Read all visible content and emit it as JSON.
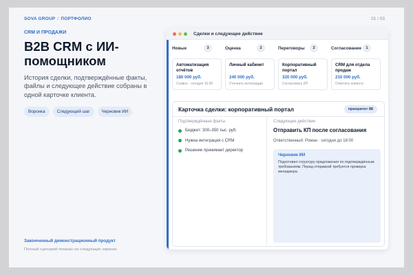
{
  "header": {
    "brand": "SOVA GROUP",
    "separator": "/",
    "section": "ПОРТФОЛИО",
    "pager": "01 / 03"
  },
  "hero": {
    "eyebrow": "CRM И ПРОДАЖИ",
    "title": "B2B CRM с ИИ-помощником",
    "description": "История сделки, подтверждённые факты, файлы и следующее действие собраны в одной карточке клиента.",
    "tags": [
      "Воронка",
      "Следующий шаг",
      "Черновик ИИ"
    ]
  },
  "footer": {
    "status": "Законченный демонстрационный продукт",
    "note": "Полный сценарий показан на следующих экранах"
  },
  "window": {
    "title": "Сделки и следующее действие",
    "dots": [
      "#f26b5e",
      "#f4be4f",
      "#5cc15a"
    ]
  },
  "pipeline": {
    "columns": [
      {
        "name": "Новые",
        "count": "3",
        "deal": {
          "name": "Автоматизация отчётов",
          "amount": "180 000 руб.",
          "note": "Созвон · сегодня 16:00"
        }
      },
      {
        "name": "Оценка",
        "count": "2",
        "deal": {
          "name": "Личный кабинет",
          "amount": "240 000 руб.",
          "note": "Уточнить интеграции"
        }
      },
      {
        "name": "Переговоры",
        "count": "2",
        "deal": {
          "name": "Корпоративный портал",
          "amount": "320 000 руб.",
          "note": "Согласовать КП"
        }
      },
      {
        "name": "Согласование",
        "count": "1",
        "deal": {
          "name": "CRM для отдела продаж",
          "amount": "210 000 руб.",
          "note": "Ответить клиенту"
        }
      }
    ]
  },
  "deal_card": {
    "title": "Карточка сделки: корпоративный портал",
    "priority": "приоритет 88",
    "facts_label": "Подтверждённые факты",
    "facts": [
      "Бюджет: 300–350 тыс. руб.",
      "Нужна интеграция с CRM",
      "Решение принимает директор"
    ],
    "next_label": "Следующее действие",
    "next_action": "Отправить КП после согласования",
    "responsible": "Ответственный: Роман · сегодня до 18:00",
    "ai_title": "Черновик ИИ",
    "ai_text": "Подготовил структуру предложения по подтверждённым требованиям. Перед отправкой требуется проверка менеджера."
  },
  "colors": {
    "accent": "#2f6fc6",
    "fact_bullet": "#27a55a",
    "heading": "#101a2c"
  }
}
